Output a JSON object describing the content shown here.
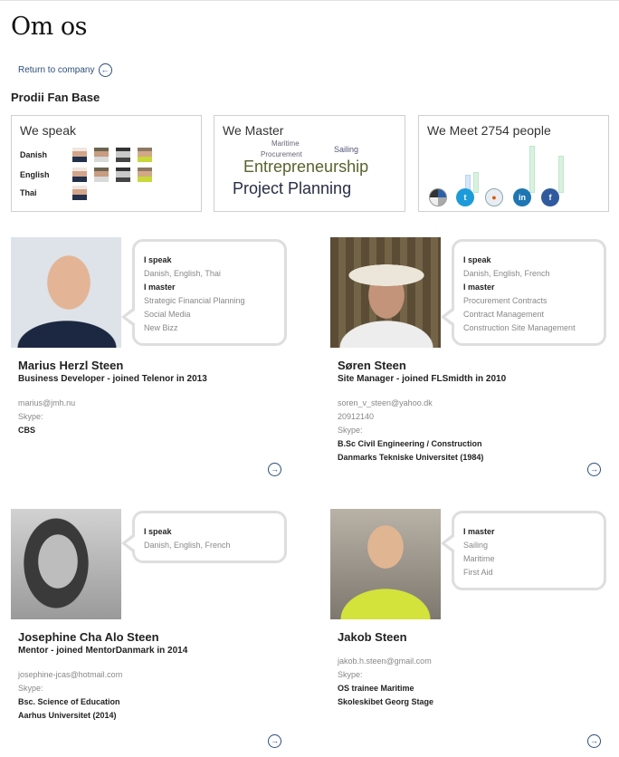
{
  "page_title": "Om os",
  "return_link": "Return to company",
  "section_title": "Prodii Fan Base",
  "speak_box": {
    "title": "We speak",
    "languages": [
      {
        "name": "Danish",
        "avatars": [
          "marius",
          "soren",
          "josephine",
          "jakob"
        ]
      },
      {
        "name": "English",
        "avatars": [
          "marius",
          "soren",
          "josephine",
          "jakob"
        ]
      },
      {
        "name": "Thai",
        "avatars": [
          "marius"
        ]
      }
    ]
  },
  "master_box": {
    "title": "We Master",
    "tags": [
      "Maritime",
      "Procurement",
      "Sailing",
      "Entrepreneurship",
      "Project Planning"
    ]
  },
  "meet_box": {
    "title": "We Meet 2754 people",
    "networks": [
      "network-mix-icon",
      "twitter-icon",
      "people-icon",
      "linkedin-icon",
      "facebook-icon"
    ]
  },
  "people": [
    {
      "name": "Marius Herzl Steen",
      "role": "Business Developer - joined Telenor in 2013",
      "speak_label": "I speak",
      "speak": "Danish, English, Thai",
      "master_label": "I master",
      "master": [
        "Strategic Financial Planning",
        "Social Media",
        "New Bizz"
      ],
      "email": "marius@jmh.nu",
      "phone": "",
      "skype": "Skype:",
      "education": [
        "CBS"
      ]
    },
    {
      "name": "Søren Steen",
      "role": "Site Manager - joined FLSmidth in 2010",
      "speak_label": "I speak",
      "speak": "Danish, English, French",
      "master_label": "I master",
      "master": [
        "Procurement Contracts",
        "Contract Management",
        "Construction Site Management"
      ],
      "email": "soren_v_steen@yahoo.dk",
      "phone": "20912140",
      "skype": "Skype:",
      "education": [
        "B.Sc Civil Engineering / Construction",
        "Danmarks Tekniske Universitet (1984)"
      ]
    },
    {
      "name": "Josephine Cha Alo Steen",
      "role": "Mentor - joined MentorDanmark in 2014",
      "speak_label": "I speak",
      "speak": "Danish, English, French",
      "email": "josephine-jcas@hotmail.com",
      "skype": "Skype:",
      "education": [
        "Bsc. Science of Education",
        "Aarhus Universitet (2014)"
      ]
    },
    {
      "name": "Jakob Steen",
      "role": "",
      "master_label": "I master",
      "master": [
        "Sailing",
        "Maritime",
        "First Aid"
      ],
      "email": "jakob.h.steen@gmail.com",
      "skype": "Skype:",
      "education": [
        "OS trainee Maritime",
        "Skoleskibet Georg Stage"
      ]
    }
  ]
}
